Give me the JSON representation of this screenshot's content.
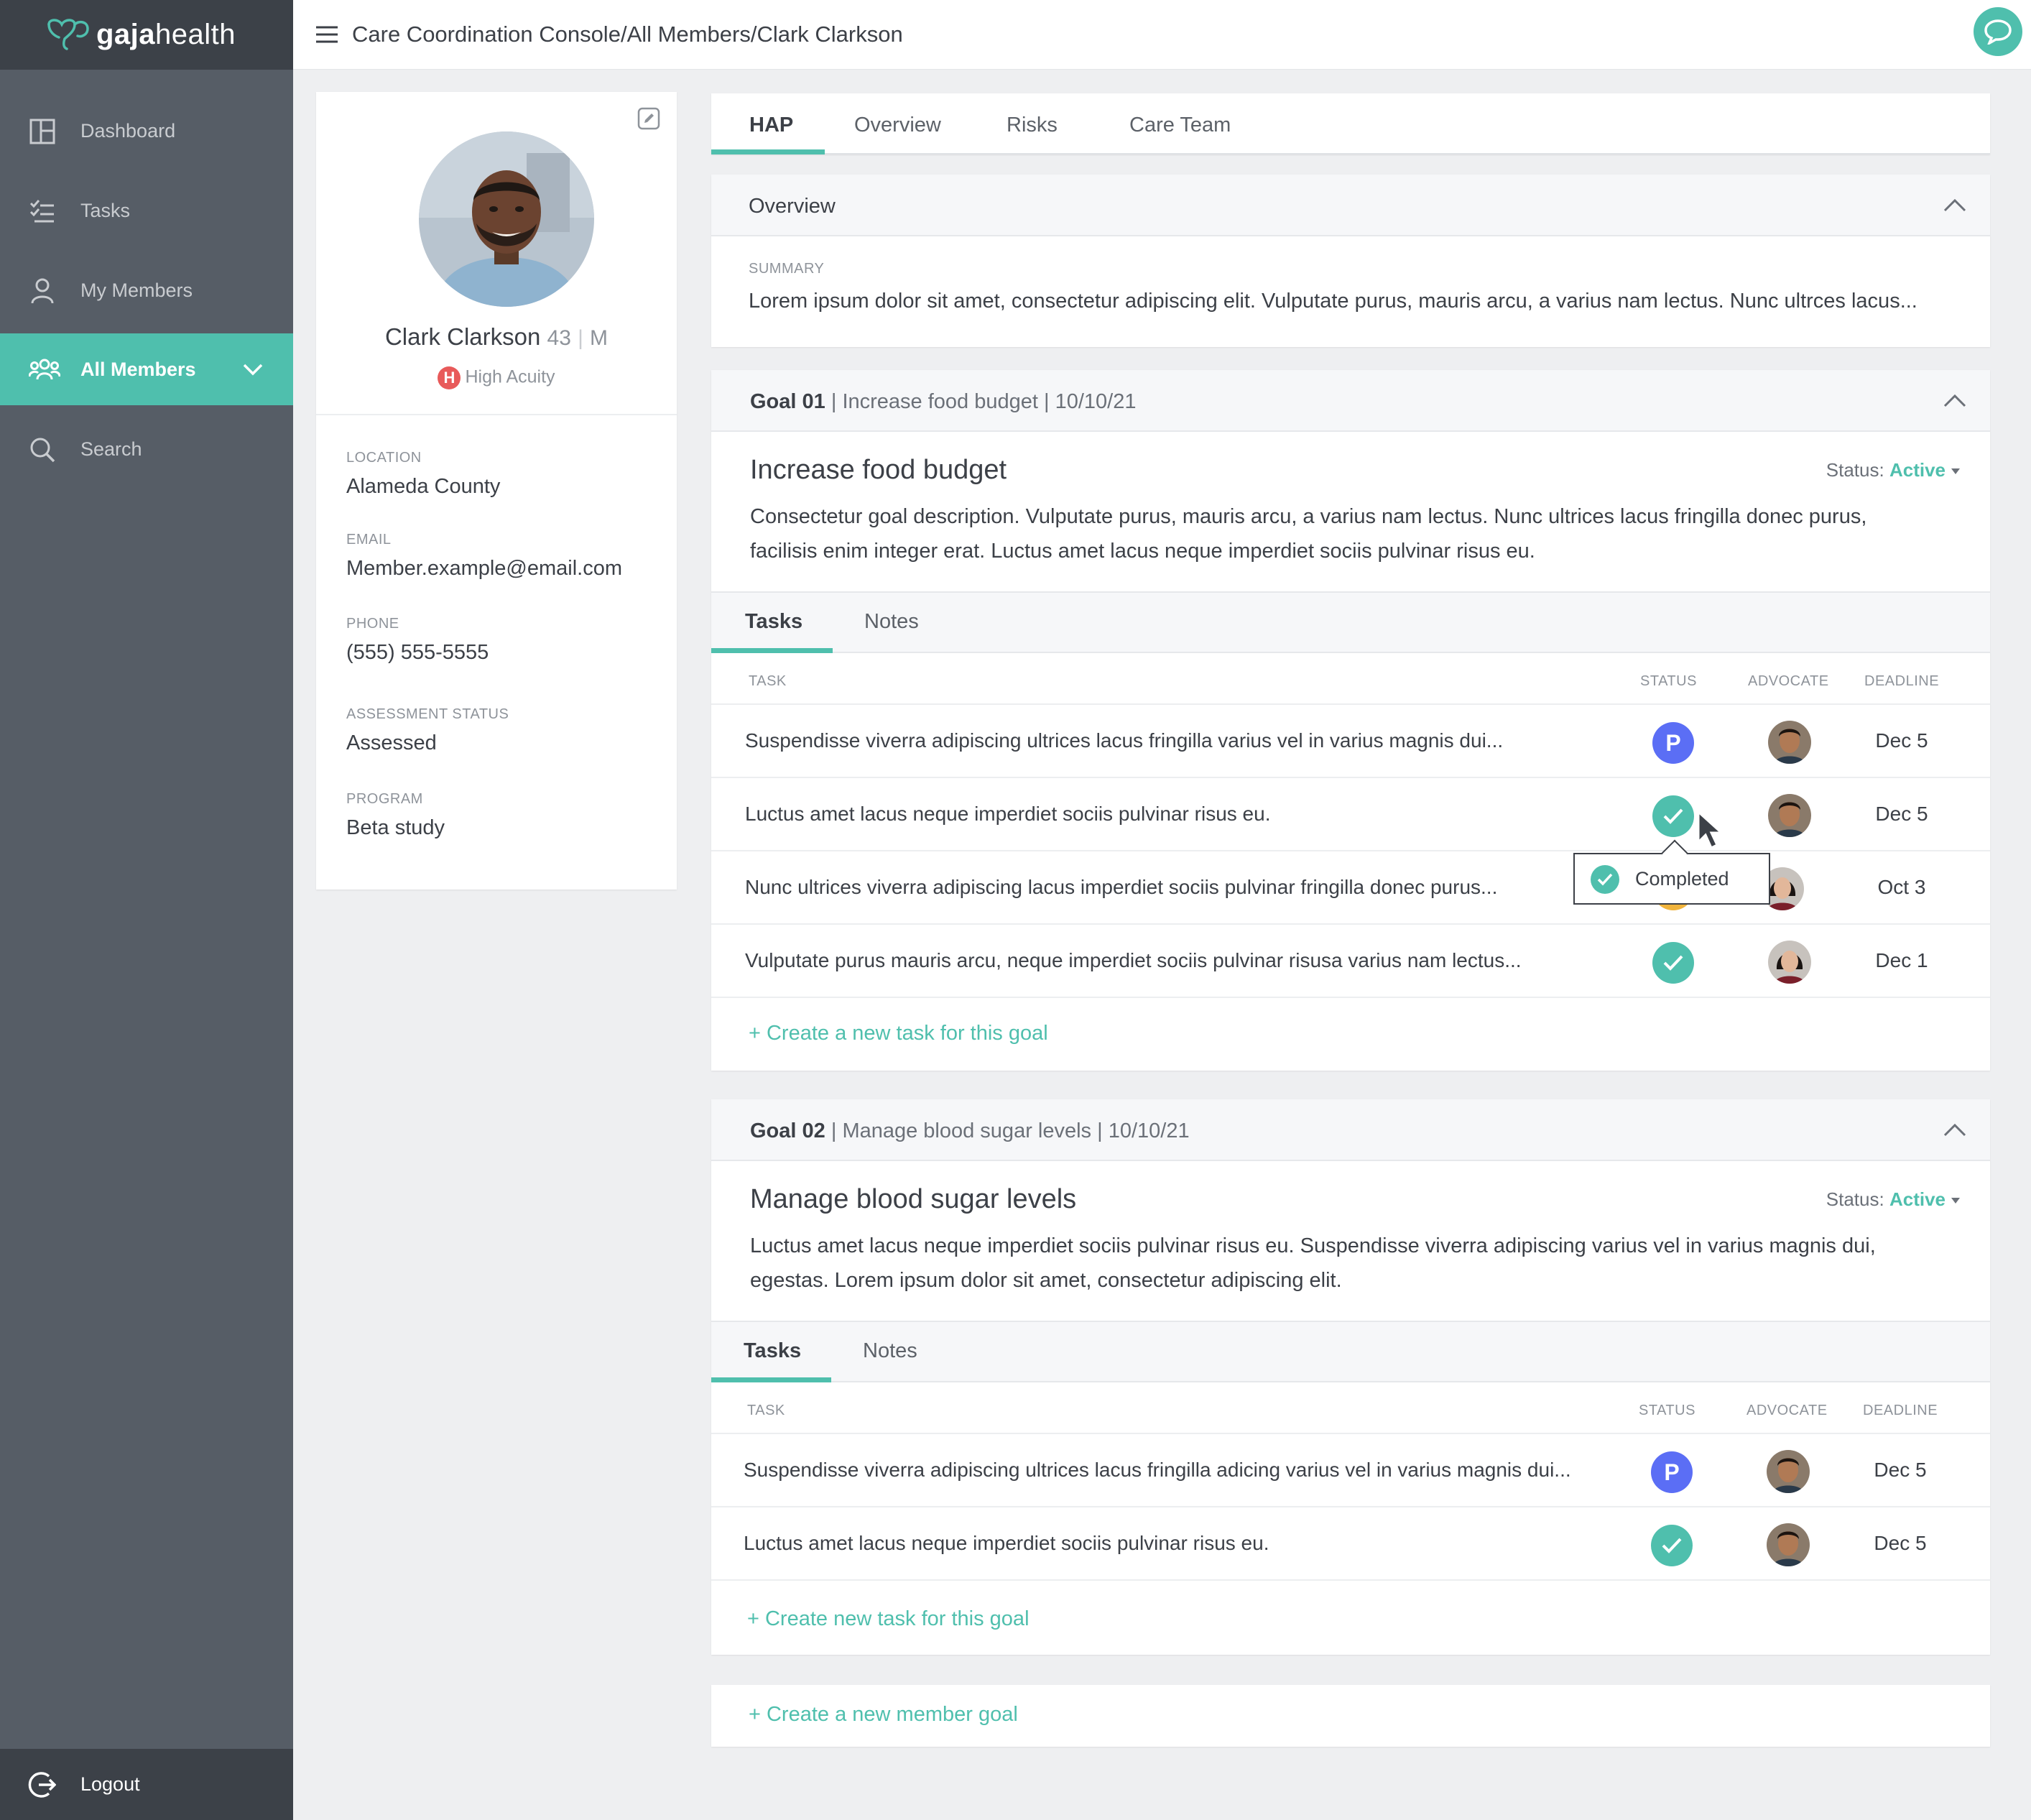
{
  "brand": {
    "name_bold": "gaja",
    "name_rest": "health"
  },
  "sidebar": {
    "items": [
      {
        "label": "Dashboard",
        "icon": "dashboard-icon"
      },
      {
        "label": "Tasks",
        "icon": "tasks-icon"
      },
      {
        "label": "My Members",
        "icon": "person-icon"
      },
      {
        "label": "All Members",
        "icon": "group-icon",
        "active": true
      },
      {
        "label": "Search",
        "icon": "search-icon"
      }
    ],
    "logout": "Logout"
  },
  "header": {
    "breadcrumb": [
      "Care Coordination Console",
      "All Members",
      "Clark Clarkson"
    ],
    "separator": "/"
  },
  "profile": {
    "name": "Clark Clarkson",
    "age": "43",
    "sex": "M",
    "acuity_badge": "H",
    "acuity": "High Acuity",
    "fields": [
      {
        "label": "LOCATION",
        "value": "Alameda County"
      },
      {
        "label": "EMAIL",
        "value": "Member.example@email.com"
      },
      {
        "label": "PHONE",
        "value": "(555) 555-5555"
      },
      {
        "label": "ASSESSMENT STATUS",
        "value": "Assessed"
      },
      {
        "label": "PROGRAM",
        "value": "Beta study"
      }
    ]
  },
  "main_tabs": [
    "HAP",
    "Overview",
    "Risks",
    "Care Team"
  ],
  "overview": {
    "title": "Overview",
    "summary_label": "SUMMARY",
    "summary": "Lorem ipsum dolor sit amet, consectetur adipiscing elit. Vulputate purus, mauris arcu, a varius nam lectus. Nunc ultrces lacus..."
  },
  "goals": [
    {
      "number": "Goal 01",
      "header_rest": "Increase food budget | 10/10/21",
      "title": "Increase food budget",
      "status_label": "Status:",
      "status": "Active",
      "description": "Consectetur goal description. Vulputate purus, mauris arcu, a varius nam lectus. Nunc ultrices lacus fringilla donec purus, facilisis enim integer erat. Luctus amet lacus neque imperdiet sociis pulvinar risus eu.",
      "subtabs": [
        "Tasks",
        "Notes"
      ],
      "columns": [
        "TASK",
        "STATUS",
        "ADVOCATE",
        "DEADLINE"
      ],
      "tasks": [
        {
          "task": "Suspendisse viverra adipiscing ultrices lacus fringilla  varius vel in varius magnis dui...",
          "status": "P",
          "deadline": "Dec 5"
        },
        {
          "task": "Luctus amet lacus neque imperdiet sociis pulvinar risus eu.",
          "status": "completed",
          "deadline": "Dec 5"
        },
        {
          "task": "Nunc ultrices viverra adipiscing lacus imperdiet sociis pulvinar fringilla donec purus...",
          "status": "in-progress",
          "deadline": "Oct 3"
        },
        {
          "task": "Vulputate purus mauris arcu, neque imperdiet sociis pulvinar risusa varius nam lectus...",
          "status": "completed",
          "deadline": "Dec 1"
        }
      ],
      "add_task": "+ Create a new task for this goal"
    },
    {
      "number": "Goal 02",
      "header_rest": "Manage blood sugar levels | 10/10/21",
      "title": "Manage blood sugar levels",
      "status_label": "Status:",
      "status": "Active",
      "description": "Luctus amet lacus neque imperdiet sociis pulvinar risus eu. Suspendisse viverra adipiscing varius vel in varius magnis dui, egestas. Lorem ipsum dolor sit amet, consectetur adipiscing elit.",
      "subtabs": [
        "Tasks",
        "Notes"
      ],
      "columns": [
        "TASK",
        "STATUS",
        "ADVOCATE",
        "DEADLINE"
      ],
      "tasks": [
        {
          "task": "Suspendisse viverra adipiscing ultrices lacus fringilla adicing varius vel in varius magnis dui...",
          "status": "P",
          "deadline": "Dec 5"
        },
        {
          "task": "Luctus amet lacus neque imperdiet sociis pulvinar risus eu.",
          "status": "completed",
          "deadline": "Dec 5"
        }
      ],
      "add_task": "+ Create new task for this goal"
    }
  ],
  "add_goal": "+ Create a new member goal",
  "tooltip": {
    "text": "Completed"
  },
  "colors": {
    "accent": "#4fbfad",
    "sidebar": "#565d66",
    "pending": "#5b6ef5",
    "in_progress": "#f1b43c",
    "acuity_high": "#e85a5a"
  }
}
